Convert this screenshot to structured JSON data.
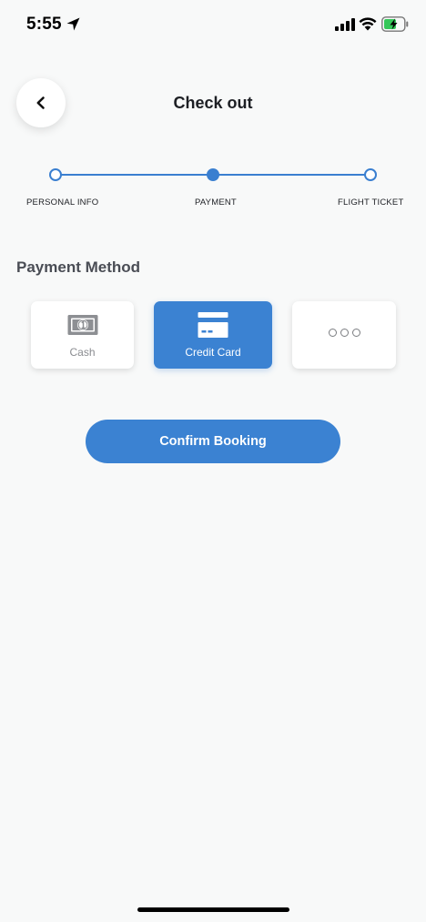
{
  "status_bar": {
    "time": "5:55",
    "icons": [
      "location-arrow-icon",
      "cellular-signal-icon",
      "wifi-icon",
      "battery-charging-icon"
    ]
  },
  "header": {
    "back_icon": "chevron-left-icon",
    "title": "Check out"
  },
  "stepper": {
    "steps": [
      {
        "label": "PERSONAL INFO",
        "state": "inactive"
      },
      {
        "label": "PAYMENT",
        "state": "active"
      },
      {
        "label": "FLIGHT TICKET",
        "state": "inactive"
      }
    ]
  },
  "payment": {
    "title": "Payment Method",
    "methods": [
      {
        "label": "Cash",
        "icon": "cash-bill-icon",
        "selected": false
      },
      {
        "label": "Credit Card",
        "icon": "credit-card-icon",
        "selected": true
      },
      {
        "label": "",
        "icon": "more-dots-icon",
        "selected": false
      }
    ]
  },
  "actions": {
    "confirm_label": "Confirm Booking"
  },
  "colors": {
    "accent": "#3b82d2",
    "background": "#f8f9f9",
    "text": "#1d1f24",
    "muted": "#8a8c90"
  }
}
